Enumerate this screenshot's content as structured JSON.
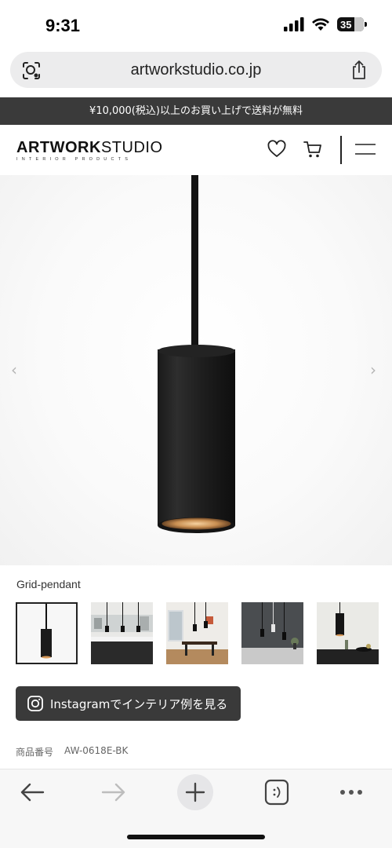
{
  "status_bar": {
    "time": "9:31",
    "battery": "35"
  },
  "browser": {
    "url": "artworkstudio.co.jp"
  },
  "promo_banner": "¥10,000(税込)以上のお買い上げで送料が無料",
  "header": {
    "logo_bold": "ARTWORK",
    "logo_light": "STUDIO",
    "logo_sub": "INTERIOR PRODUCTS"
  },
  "product": {
    "name": "Grid-pendant",
    "sku_label": "商品番号",
    "sku_value": "AW-0618E-BK",
    "thumbnails": [
      "pendant-black",
      "kitchen-scene",
      "dining-room",
      "dark-wall-scene",
      "table-scene"
    ]
  },
  "instagram_button": "Instagramでインテリア例を見る",
  "icons": {
    "lens": "visual-lookup-icon",
    "share": "share-icon",
    "favorite": "heart-icon",
    "cart": "cart-icon",
    "menu": "hamburger-menu-icon",
    "back": "back-arrow-icon",
    "forward": "forward-arrow-icon",
    "new_tab": "plus-icon",
    "tabs": "tabs-icon",
    "more": "more-icon"
  },
  "colors": {
    "banner": "#3a3a3a",
    "accent": "#111111"
  }
}
